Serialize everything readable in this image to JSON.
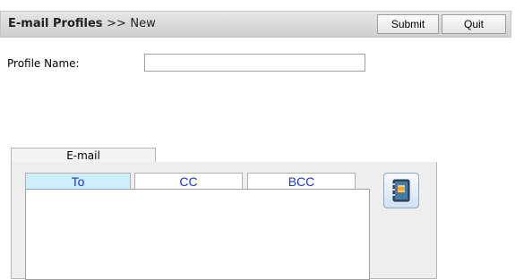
{
  "header": {
    "title": "E-mail Profiles",
    "separator": ">>",
    "subtitle": "New",
    "submit_label": "Submit",
    "quit_label": "Quit"
  },
  "form": {
    "profile_name_label": "Profile Name:",
    "profile_name_value": "",
    "email_tab_label": "E-mail",
    "recipient_tabs": [
      {
        "label": "To",
        "active": true
      },
      {
        "label": "CC",
        "active": false
      },
      {
        "label": "BCC",
        "active": false
      }
    ],
    "recipients_value": "",
    "address_book_icon": "address-book-icon"
  },
  "colors": {
    "header_bg": "#d6d6d6",
    "active_tab_bg": "#cdeefb",
    "tab_text": "#1a33cc",
    "panel_bg": "#eeeeee"
  }
}
